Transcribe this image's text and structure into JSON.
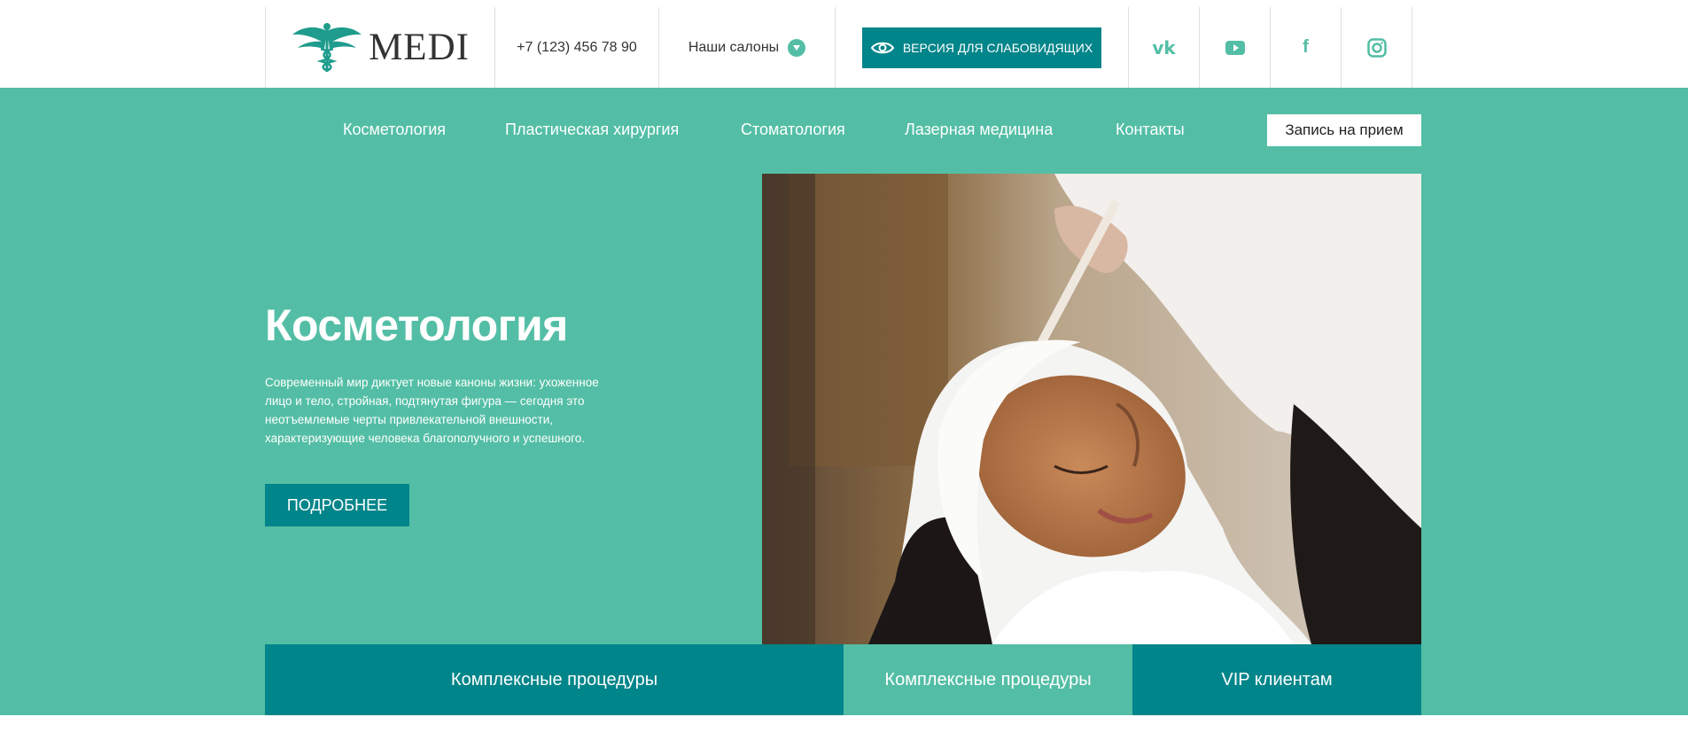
{
  "header": {
    "logo_text": "MEDI",
    "phone": "+7 (123) 456 78 90",
    "salons_label": "Наши салоны",
    "accessibility_label": "ВЕРСИЯ ДЛЯ СЛАБОВИДЯЩИХ",
    "social": [
      {
        "name": "vk-icon",
        "glyph": "vk"
      },
      {
        "name": "youtube-icon"
      },
      {
        "name": "facebook-icon",
        "glyph": "f"
      },
      {
        "name": "instagram-icon"
      }
    ]
  },
  "nav": {
    "items": [
      {
        "label": "Косметология"
      },
      {
        "label": "Пластическая хирургия"
      },
      {
        "label": "Стоматология"
      },
      {
        "label": "Лазерная медицина"
      },
      {
        "label": "Контакты"
      }
    ],
    "book_label": "Запись на прием"
  },
  "hero": {
    "title": "Косметология",
    "description": "Современный мир диктует новые каноны жизни: ухоженное лицо и тело, стройная, подтянутая фигура — сегодня это неотъемлемые черты привлекательной внешности, характеризующие человека благополучного и успешного.",
    "more_label": "ПОДРОБНЕЕ"
  },
  "tabs": [
    {
      "label": "Комплексные процедуры"
    },
    {
      "label": "Комплексные процедуры"
    },
    {
      "label": "VIP клиентам"
    }
  ],
  "colors": {
    "brand_mint": "#53bea5",
    "brand_teal": "#00858a"
  }
}
